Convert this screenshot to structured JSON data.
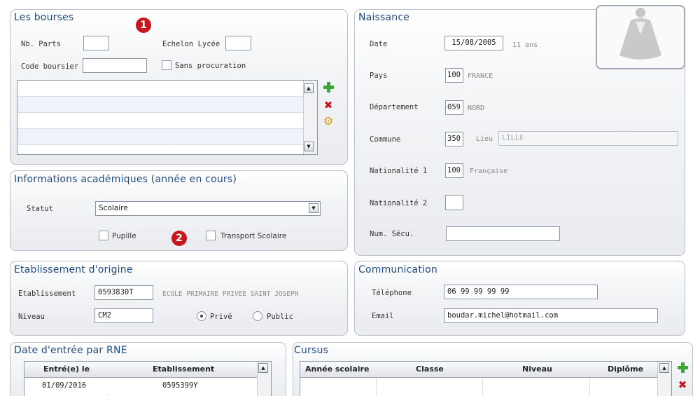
{
  "markers": {
    "one": "1",
    "two": "2"
  },
  "bourses": {
    "title": "Les bourses",
    "nb_parts_label": "Nb. Parts",
    "nb_parts_value": "",
    "echelon_label": "Echelon Lycée",
    "echelon_value": "",
    "code_boursier_label": "Code boursier",
    "code_boursier_value": "",
    "sans_procuration_label": "Sans procuration",
    "list_rows": [
      "",
      "",
      "",
      ""
    ]
  },
  "academique": {
    "title": "Informations académiques (année en cours)",
    "statut_label": "Statut",
    "statut_value": "Scolaire",
    "pupille_label": "Pupille",
    "transport_label": "Transport Scolaire"
  },
  "naissance": {
    "title": "Naissance",
    "date_label": "Date",
    "date_value": "15/08/2005",
    "age_text": "11 ans",
    "pays_label": "Pays",
    "pays_code": "100",
    "pays_name": "FRANCE",
    "departement_label": "Département",
    "departement_code": "059",
    "departement_name": "NORD",
    "commune_label": "Commune",
    "commune_code": "350",
    "lieu_label": "Lieu",
    "lieu_value": "LILLE",
    "nationalite1_label": "Nationalité 1",
    "nationalite1_code": "100",
    "nationalite1_name": "Française",
    "nationalite2_label": "Nationalité 2",
    "nationalite2_code": "",
    "num_secu_label": "Num. Sécu.",
    "num_secu_value": ""
  },
  "etablissement": {
    "title": "Etablissement d'origine",
    "etab_label": "Etablissement",
    "etab_code": "0593830T",
    "etab_name": "ECOLE PRIMAIRE PRIVEE SAINT JOSEPH",
    "niveau_label": "Niveau",
    "niveau_value": "CM2",
    "prive_label": "Privé",
    "public_label": "Public",
    "selected": "Privé"
  },
  "communication": {
    "title": "Communication",
    "telephone_label": "Téléphone",
    "telephone_value": "06 99 99 99 99",
    "email_label": "Email",
    "email_value": "boudar.michel@hotmail.com"
  },
  "rne": {
    "title": "Date d'entrée par RNE",
    "columns": [
      "Entré(e) le",
      "Etablissement"
    ],
    "rows": [
      {
        "date": "01/09/2016",
        "etab": "0595399Y"
      }
    ]
  },
  "cursus": {
    "title": "Cursus",
    "columns": [
      "Année scolaire",
      "Classe",
      "Niveau",
      "Diplôme"
    ]
  },
  "colors": {
    "title_blue": "#1f4a80",
    "marker_red": "#c8161d",
    "add_green": "#3aa63a"
  },
  "icons": [
    "plus-icon",
    "delete-icon",
    "gear-icon",
    "scroll-up-icon",
    "scroll-down-icon",
    "dropdown-arrow-icon",
    "photo-placeholder-icon"
  ]
}
